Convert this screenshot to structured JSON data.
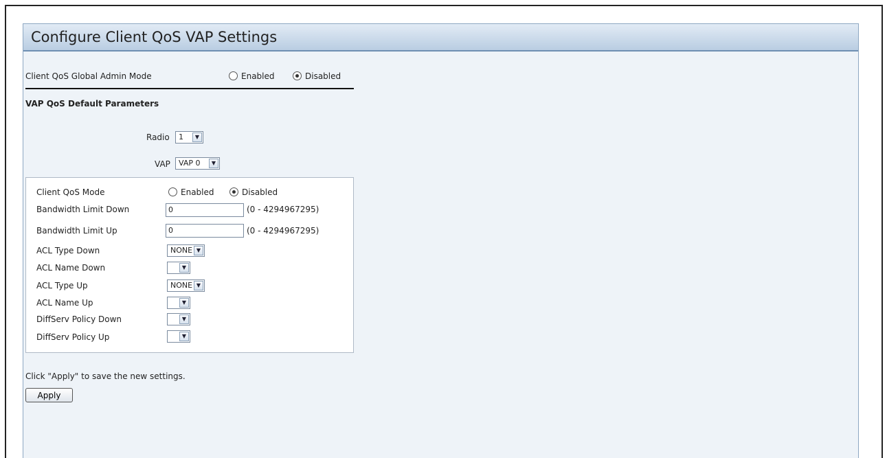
{
  "title": "Configure Client QoS VAP Settings",
  "global": {
    "label": "Client QoS Global Admin Mode",
    "enabled_label": "Enabled",
    "disabled_label": "Disabled",
    "selected": "Disabled"
  },
  "section_title": "VAP QoS Default Parameters",
  "radio_select": {
    "label": "Radio",
    "value": "1"
  },
  "vap_select": {
    "label": "VAP",
    "value": "VAP 0"
  },
  "params": {
    "client_qos_mode": {
      "label": "Client QoS Mode",
      "enabled_label": "Enabled",
      "disabled_label": "Disabled",
      "selected": "Disabled"
    },
    "bandwidth_down": {
      "label": "Bandwidth Limit Down",
      "value": "0",
      "range": "(0 - 4294967295)"
    },
    "bandwidth_up": {
      "label": "Bandwidth Limit Up",
      "value": "0",
      "range": "(0 - 4294967295)"
    },
    "acl_type_down": {
      "label": "ACL Type Down",
      "value": "NONE"
    },
    "acl_name_down": {
      "label": "ACL Name Down",
      "value": ""
    },
    "acl_type_up": {
      "label": "ACL Type Up",
      "value": "NONE"
    },
    "acl_name_up": {
      "label": "ACL Name Up",
      "value": ""
    },
    "diffserv_down": {
      "label": "DiffServ Policy Down",
      "value": ""
    },
    "diffserv_up": {
      "label": "DiffServ Policy Up",
      "value": ""
    }
  },
  "apply_hint": "Click \"Apply\" to save the new settings.",
  "apply_label": "Apply",
  "icons": {
    "dropdown": "chevron-down-icon"
  },
  "colors": {
    "panel_bg": "#eef3f8",
    "header_border": "#6e8fb2"
  }
}
